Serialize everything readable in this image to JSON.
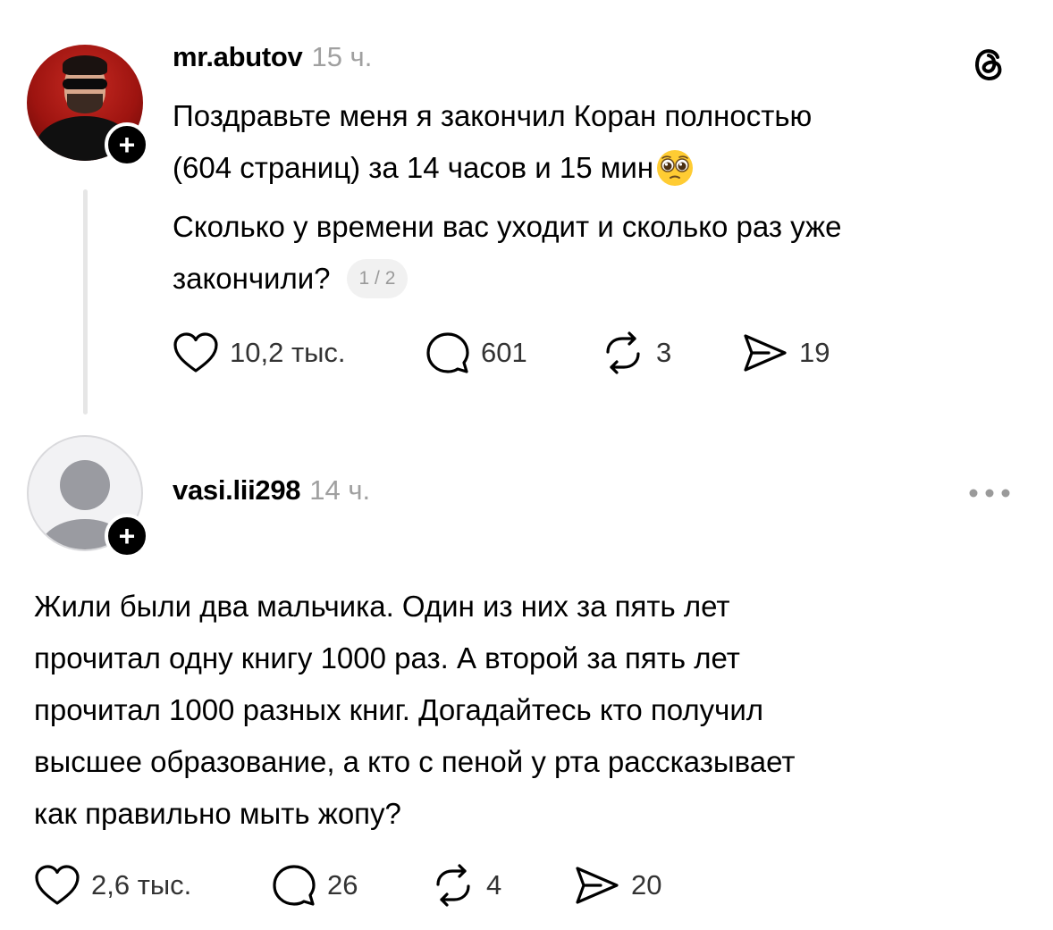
{
  "posts": [
    {
      "username": "mr.abutov",
      "time": "15 ч.",
      "lines": [
        "Поздравьте меня я закончил Коран полностью",
        "(604 страниц) за 14 часов и 15 мин",
        "Сколько у времени вас уходит и сколько раз уже",
        "закончили?"
      ],
      "emoji": "pleading-face-emoji",
      "page_indicator": "1 / 2",
      "likes": "10,2 тыс.",
      "comments": "601",
      "reposts": "3",
      "shares": "19"
    },
    {
      "username": "vasi.lii298",
      "time": "14 ч.",
      "lines": [
        "Жили были два мальчика. Один из них за пять лет",
        "прочитал одну книгу 1000 раз. А второй за пять лет",
        "прочитал 1000 разных книг. Догадайтесь кто получил",
        "высшее образование, а кто с пеной у рта рассказывает",
        "как правильно мыть жопу?"
      ],
      "likes": "2,6 тыс.",
      "comments": "26",
      "reposts": "4",
      "shares": "20"
    }
  ],
  "icons": {
    "app_logo": "threads-logo-icon",
    "more": "more-options-icon",
    "like": "heart-icon",
    "comment": "comment-icon",
    "repost": "repost-icon",
    "share": "share-icon",
    "follow": "plus-icon"
  },
  "colors": {
    "text": "#000000",
    "secondary": "#a0a0a0",
    "thread_line": "#e6e6e6"
  }
}
